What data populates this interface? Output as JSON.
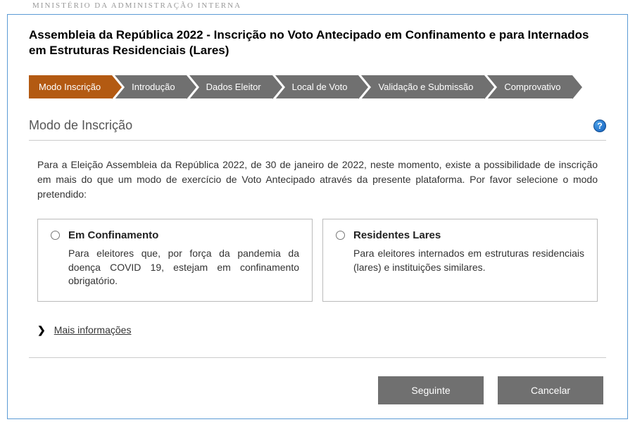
{
  "ministry": "MINISTÉRIO DA ADMINISTRAÇÃO INTERNA",
  "page_title": "Assembleia da República 2022 - Inscrição no Voto Antecipado em Confinamento e para Internados em Estruturas Residenciais (Lares)",
  "steps": {
    "s0": "Modo Inscrição",
    "s1": "Introdução",
    "s2": "Dados Eleitor",
    "s3": "Local de Voto",
    "s4": "Validação e Submissão",
    "s5": "Comprovativo"
  },
  "section_title": "Modo de Inscrição",
  "help_glyph": "?",
  "intro_text": "Para a Eleição Assembleia da República 2022, de 30 de janeiro de 2022, neste momento, existe a possibilidade de inscrição em mais do que um modo de exercício de Voto Antecipado através da presente plataforma. Por favor selecione o modo pretendido:",
  "options": {
    "confinamento": {
      "title": "Em Confinamento",
      "desc": "Para eleitores que, por força da pandemia da doença COVID 19, estejam em confinamento obrigatório."
    },
    "lares": {
      "title": "Residentes Lares",
      "desc": "Para eleitores internados em estruturas residenciais (lares) e instituições similares."
    }
  },
  "more_info_label": "Mais informações",
  "buttons": {
    "next": "Seguinte",
    "cancel": "Cancelar"
  }
}
